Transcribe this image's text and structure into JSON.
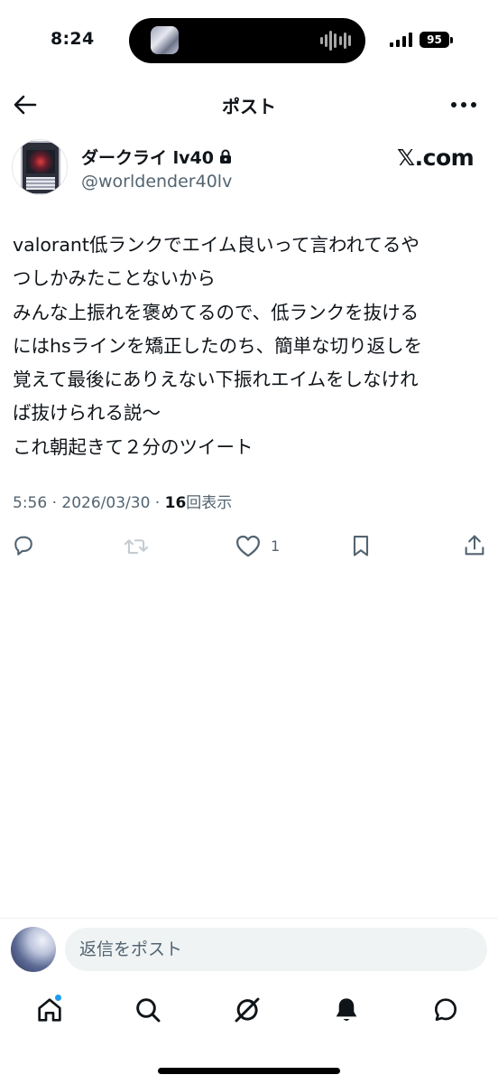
{
  "status_bar": {
    "time": "8:24",
    "battery": "95"
  },
  "header": {
    "title": "ポスト",
    "back_icon": "arrow-left-icon",
    "more_icon": "more-horizontal-icon"
  },
  "author": {
    "display_name": "ダークライ lv40",
    "handle": "@worldender40lv",
    "locked": true,
    "source_badge": "𝕏.com"
  },
  "post": {
    "text": "valorant低ランクでエイム良いって言われてるや\nつしかみたことないから\nみんな上振れを褒めてるので、低ランクを抜ける\nにはhsラインを矯正したのち、簡単な切り返しを\n覚えて最後にありえない下振れエイムをしなけれ\nば抜けられる説〜\nこれ朝起きて２分のツイート",
    "time": "5:56",
    "separator": "·",
    "date": "2026/03/30",
    "separator2": "·",
    "views_count": "16",
    "views_label": "回表示"
  },
  "actions": {
    "reply_icon": "reply-icon",
    "repost_icon": "repost-icon",
    "like_icon": "heart-icon",
    "like_count": "1",
    "bookmark_icon": "bookmark-icon",
    "share_icon": "share-icon"
  },
  "reply_bar": {
    "placeholder": "返信をポスト"
  },
  "tabbar": {
    "items": [
      "home-icon",
      "search-icon",
      "grok-icon",
      "notifications-icon",
      "messages-icon"
    ],
    "home_has_badge": true
  },
  "colors": {
    "text": "#0f1419",
    "secondary": "#536471",
    "accent": "#1d9bf0",
    "input_bg": "#eff3f4"
  }
}
